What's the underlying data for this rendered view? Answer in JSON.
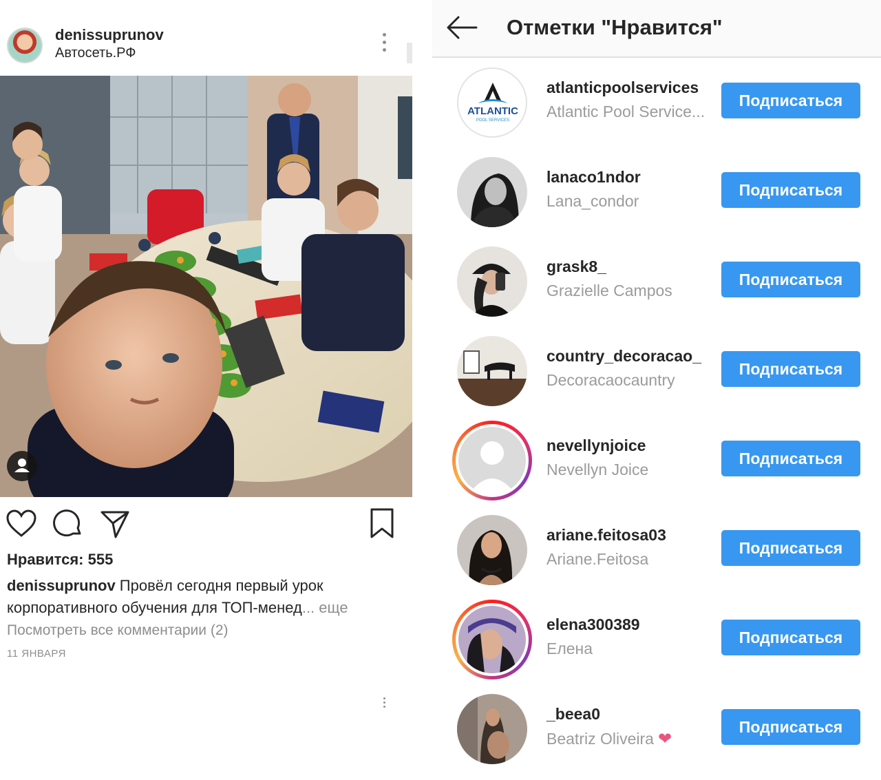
{
  "post": {
    "username": "denissuprunov",
    "location": "Автосеть.РФ",
    "likes_text": "Нравится: 555",
    "caption_user": "denissuprunov",
    "caption_text": " Провёл сегодня первый урок корпоративного обучения для ТОП-менед",
    "caption_ellipsis": "... еще",
    "view_comments": "Посмотреть все комментарии (2)",
    "date": "11 ЯНВАРЯ"
  },
  "likes_page": {
    "title": "Отметки \"Нравится\"",
    "users": [
      {
        "username": "atlanticpoolservices",
        "full_name": "Atlantic Pool Service...",
        "button": "Подписаться",
        "story_ring": false,
        "avatar": "atlantic-logo"
      },
      {
        "username": "lanaco1ndor",
        "full_name": "Lana_condor",
        "button": "Подписаться",
        "story_ring": false,
        "avatar": "photo"
      },
      {
        "username": "grask8_",
        "full_name": "Grazielle Campos",
        "button": "Подписаться",
        "story_ring": false,
        "avatar": "photo"
      },
      {
        "username": "country_decoracao_",
        "full_name": "Decoracaocauntry",
        "button": "Подписаться",
        "story_ring": false,
        "avatar": "photo"
      },
      {
        "username": "nevellynjoice",
        "full_name": "Nevellyn Joice",
        "button": "Подписаться",
        "story_ring": true,
        "avatar": "default-user"
      },
      {
        "username": "ariane.feitosa03",
        "full_name": "Ariane.Feitosa",
        "button": "Подписаться",
        "story_ring": false,
        "avatar": "photo"
      },
      {
        "username": "elena300389",
        "full_name": "Елена",
        "button": "Подписаться",
        "story_ring": true,
        "avatar": "photo"
      },
      {
        "username": "_beea0",
        "full_name": "Beatriz Oliveira",
        "button": "Подписаться",
        "story_ring": false,
        "avatar": "photo",
        "emoji": "heart"
      }
    ]
  },
  "logo": {
    "atlantic_word": "ATLANTIC",
    "atlantic_sub": "POOL SERVICES"
  },
  "colors": {
    "follow_blue": "#3897f0",
    "muted_gray": "#8e8e8e"
  }
}
